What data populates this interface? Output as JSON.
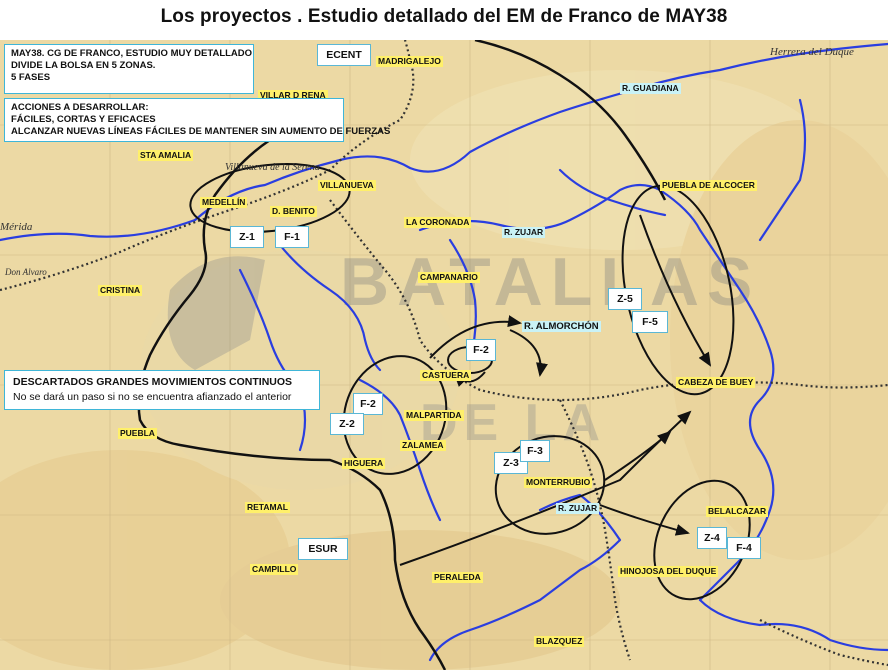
{
  "title": "Los proyectos . Estudio detallado  del EM de Franco de MAY38",
  "info": {
    "study": [
      "MAY38. CG DE FRANCO, ESTUDIO MUY DETALLADO",
      "DIVIDE LA BOLSA EN 5 ZONAS.",
      "5 FASES"
    ],
    "actions": [
      "ACCIONES A DESARROLLAR:",
      "FÁCILES, CORTAS Y EFICACES",
      "ALCANZAR NUEVAS LÍNEAS FÁCILES DE MANTENER SIN AUMENTO DE FUERZAS"
    ],
    "discarded": [
      "DESCARTADOS GRANDES MOVIMIENTOS CONTINUOS",
      "No se dará un paso si no se encuentra afianzado el anterior"
    ]
  },
  "tags": {
    "ecent": "ECENT",
    "esur": "ESUR",
    "z1": "Z-1",
    "f1": "F-1",
    "z2": "Z-2",
    "f2a": "F-2",
    "f2b": "F-2",
    "z3": "Z-3",
    "f3": "F-3",
    "z4": "Z-4",
    "f4": "F-4",
    "z5": "Z-5",
    "f5": "F-5"
  },
  "places": {
    "madrigalejo": "MADRIGALEJO",
    "villar_rena": "VILLAR D RENA",
    "sta_amalia": "STA AMALIA",
    "villanueva": "VILLANUEVA",
    "medellin": "MEDELLÍN",
    "d_benito": "D. BENITO",
    "la_coronada": "LA CORONADA",
    "r_guadiana": "R. GUADIANA",
    "r_zujar_n": "R. ZUJAR",
    "puebla_alcocer": "PUEBLA DE ALCOCER",
    "cristina": "CRISTINA",
    "campanario": "CAMPANARIO",
    "r_almorchon": "R. ALMORCHÓN",
    "castuera": "CASTUERA",
    "cabeza_buey": "CABEZA DE BUEY",
    "malpartida": "MALPARTIDA",
    "zalamea": "ZALAMEA",
    "higuera": "HIGUERA",
    "puebla": "PUEBLA",
    "monterrubio": "MONTERRUBIO",
    "r_zujar_s": "R. ZUJAR",
    "belalcazar": "BELALCAZAR",
    "retamal": "RETAMAL",
    "campillo": "CAMPILLO",
    "peraleda": "PERALEDA",
    "hinojosa": "HINOJOSA DEL DUQUE",
    "blazquez": "BLAZQUEZ"
  },
  "map_labels": {
    "herrera": "Herrera del Duque",
    "villanueva_serena": "Villanueva de la Serena",
    "merida": "Mérida",
    "don_alvaro": "Don Alvaro"
  },
  "colors": {
    "river": "#2a3ee0",
    "front": "#111111",
    "railway": "#333333",
    "box_border": "#3fb6d8",
    "highlight_yellow": "#fff06a",
    "highlight_cyan": "#c9f2f6",
    "map_base": "#ecd9a4"
  }
}
